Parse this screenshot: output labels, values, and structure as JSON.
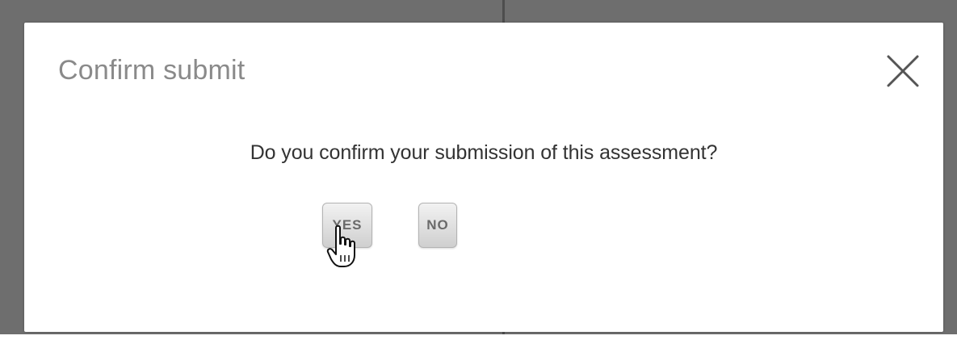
{
  "dialog": {
    "title": "Confirm submit",
    "close_icon": "close-icon",
    "message": "Do you confirm your submission of this assessment?",
    "buttons": {
      "yes_label": "YES",
      "no_label": "NO"
    }
  },
  "cursor": {
    "icon": "hand-pointer-icon"
  },
  "colors": {
    "backdrop": "#6e6e6e",
    "dialog_background": "#ffffff",
    "title": "#8a8a8a",
    "message": "#333333",
    "button_text": "#6a6a6a"
  }
}
